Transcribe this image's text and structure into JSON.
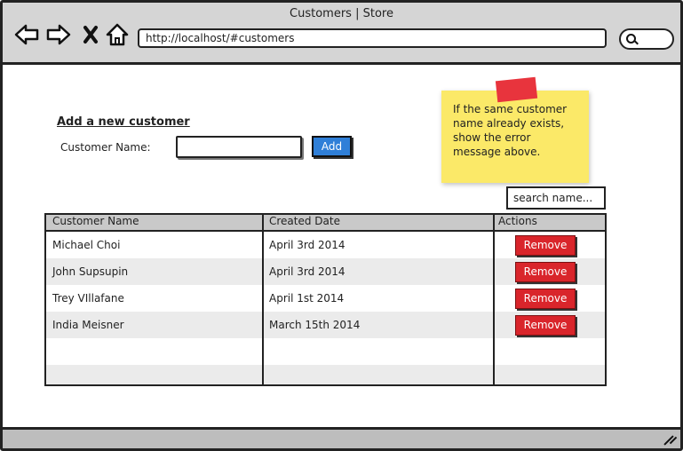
{
  "window": {
    "title": "Customers | Store",
    "address": "http://localhost/#customers"
  },
  "nav_icons": [
    "back-arrow-icon",
    "forward-arrow-icon",
    "close-x-icon",
    "home-icon",
    "search-icon"
  ],
  "form": {
    "heading": "Add a new customer",
    "label": "Customer Name:",
    "value": "",
    "add_label": "Add"
  },
  "note": {
    "text": "If the same customer name already exists, show the error message above."
  },
  "table": {
    "search_placeholder": "search name...",
    "columns": [
      "Customer Name",
      "Created Date",
      "Actions"
    ],
    "rows": [
      {
        "name": "Michael Choi",
        "date": "April 3rd 2014",
        "action": "Remove"
      },
      {
        "name": "John Supsupin",
        "date": "April 3rd 2014",
        "action": "Remove"
      },
      {
        "name": "Trey VIllafane",
        "date": "April 1st 2014",
        "action": "Remove"
      },
      {
        "name": "India Meisner",
        "date": "March 15th 2014",
        "action": "Remove"
      }
    ]
  },
  "colors": {
    "add_button": "#2f7fd8",
    "remove_button": "#d9252b",
    "sticky_note": "#fbe968",
    "tape": "#e8343d"
  }
}
